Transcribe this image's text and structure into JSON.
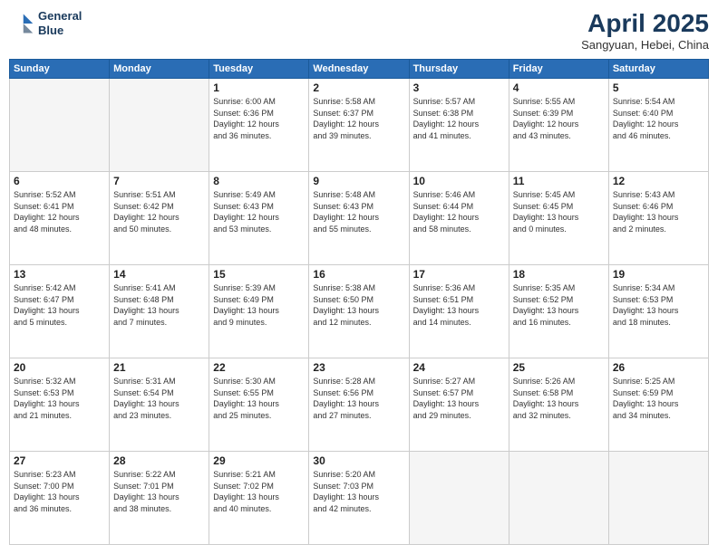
{
  "header": {
    "logo_line1": "General",
    "logo_line2": "Blue",
    "month": "April 2025",
    "location": "Sangyuan, Hebei, China"
  },
  "weekdays": [
    "Sunday",
    "Monday",
    "Tuesday",
    "Wednesday",
    "Thursday",
    "Friday",
    "Saturday"
  ],
  "weeks": [
    [
      {
        "day": "",
        "info": ""
      },
      {
        "day": "",
        "info": ""
      },
      {
        "day": "1",
        "info": "Sunrise: 6:00 AM\nSunset: 6:36 PM\nDaylight: 12 hours\nand 36 minutes."
      },
      {
        "day": "2",
        "info": "Sunrise: 5:58 AM\nSunset: 6:37 PM\nDaylight: 12 hours\nand 39 minutes."
      },
      {
        "day": "3",
        "info": "Sunrise: 5:57 AM\nSunset: 6:38 PM\nDaylight: 12 hours\nand 41 minutes."
      },
      {
        "day": "4",
        "info": "Sunrise: 5:55 AM\nSunset: 6:39 PM\nDaylight: 12 hours\nand 43 minutes."
      },
      {
        "day": "5",
        "info": "Sunrise: 5:54 AM\nSunset: 6:40 PM\nDaylight: 12 hours\nand 46 minutes."
      }
    ],
    [
      {
        "day": "6",
        "info": "Sunrise: 5:52 AM\nSunset: 6:41 PM\nDaylight: 12 hours\nand 48 minutes."
      },
      {
        "day": "7",
        "info": "Sunrise: 5:51 AM\nSunset: 6:42 PM\nDaylight: 12 hours\nand 50 minutes."
      },
      {
        "day": "8",
        "info": "Sunrise: 5:49 AM\nSunset: 6:43 PM\nDaylight: 12 hours\nand 53 minutes."
      },
      {
        "day": "9",
        "info": "Sunrise: 5:48 AM\nSunset: 6:43 PM\nDaylight: 12 hours\nand 55 minutes."
      },
      {
        "day": "10",
        "info": "Sunrise: 5:46 AM\nSunset: 6:44 PM\nDaylight: 12 hours\nand 58 minutes."
      },
      {
        "day": "11",
        "info": "Sunrise: 5:45 AM\nSunset: 6:45 PM\nDaylight: 13 hours\nand 0 minutes."
      },
      {
        "day": "12",
        "info": "Sunrise: 5:43 AM\nSunset: 6:46 PM\nDaylight: 13 hours\nand 2 minutes."
      }
    ],
    [
      {
        "day": "13",
        "info": "Sunrise: 5:42 AM\nSunset: 6:47 PM\nDaylight: 13 hours\nand 5 minutes."
      },
      {
        "day": "14",
        "info": "Sunrise: 5:41 AM\nSunset: 6:48 PM\nDaylight: 13 hours\nand 7 minutes."
      },
      {
        "day": "15",
        "info": "Sunrise: 5:39 AM\nSunset: 6:49 PM\nDaylight: 13 hours\nand 9 minutes."
      },
      {
        "day": "16",
        "info": "Sunrise: 5:38 AM\nSunset: 6:50 PM\nDaylight: 13 hours\nand 12 minutes."
      },
      {
        "day": "17",
        "info": "Sunrise: 5:36 AM\nSunset: 6:51 PM\nDaylight: 13 hours\nand 14 minutes."
      },
      {
        "day": "18",
        "info": "Sunrise: 5:35 AM\nSunset: 6:52 PM\nDaylight: 13 hours\nand 16 minutes."
      },
      {
        "day": "19",
        "info": "Sunrise: 5:34 AM\nSunset: 6:53 PM\nDaylight: 13 hours\nand 18 minutes."
      }
    ],
    [
      {
        "day": "20",
        "info": "Sunrise: 5:32 AM\nSunset: 6:53 PM\nDaylight: 13 hours\nand 21 minutes."
      },
      {
        "day": "21",
        "info": "Sunrise: 5:31 AM\nSunset: 6:54 PM\nDaylight: 13 hours\nand 23 minutes."
      },
      {
        "day": "22",
        "info": "Sunrise: 5:30 AM\nSunset: 6:55 PM\nDaylight: 13 hours\nand 25 minutes."
      },
      {
        "day": "23",
        "info": "Sunrise: 5:28 AM\nSunset: 6:56 PM\nDaylight: 13 hours\nand 27 minutes."
      },
      {
        "day": "24",
        "info": "Sunrise: 5:27 AM\nSunset: 6:57 PM\nDaylight: 13 hours\nand 29 minutes."
      },
      {
        "day": "25",
        "info": "Sunrise: 5:26 AM\nSunset: 6:58 PM\nDaylight: 13 hours\nand 32 minutes."
      },
      {
        "day": "26",
        "info": "Sunrise: 5:25 AM\nSunset: 6:59 PM\nDaylight: 13 hours\nand 34 minutes."
      }
    ],
    [
      {
        "day": "27",
        "info": "Sunrise: 5:23 AM\nSunset: 7:00 PM\nDaylight: 13 hours\nand 36 minutes."
      },
      {
        "day": "28",
        "info": "Sunrise: 5:22 AM\nSunset: 7:01 PM\nDaylight: 13 hours\nand 38 minutes."
      },
      {
        "day": "29",
        "info": "Sunrise: 5:21 AM\nSunset: 7:02 PM\nDaylight: 13 hours\nand 40 minutes."
      },
      {
        "day": "30",
        "info": "Sunrise: 5:20 AM\nSunset: 7:03 PM\nDaylight: 13 hours\nand 42 minutes."
      },
      {
        "day": "",
        "info": ""
      },
      {
        "day": "",
        "info": ""
      },
      {
        "day": "",
        "info": ""
      }
    ]
  ]
}
